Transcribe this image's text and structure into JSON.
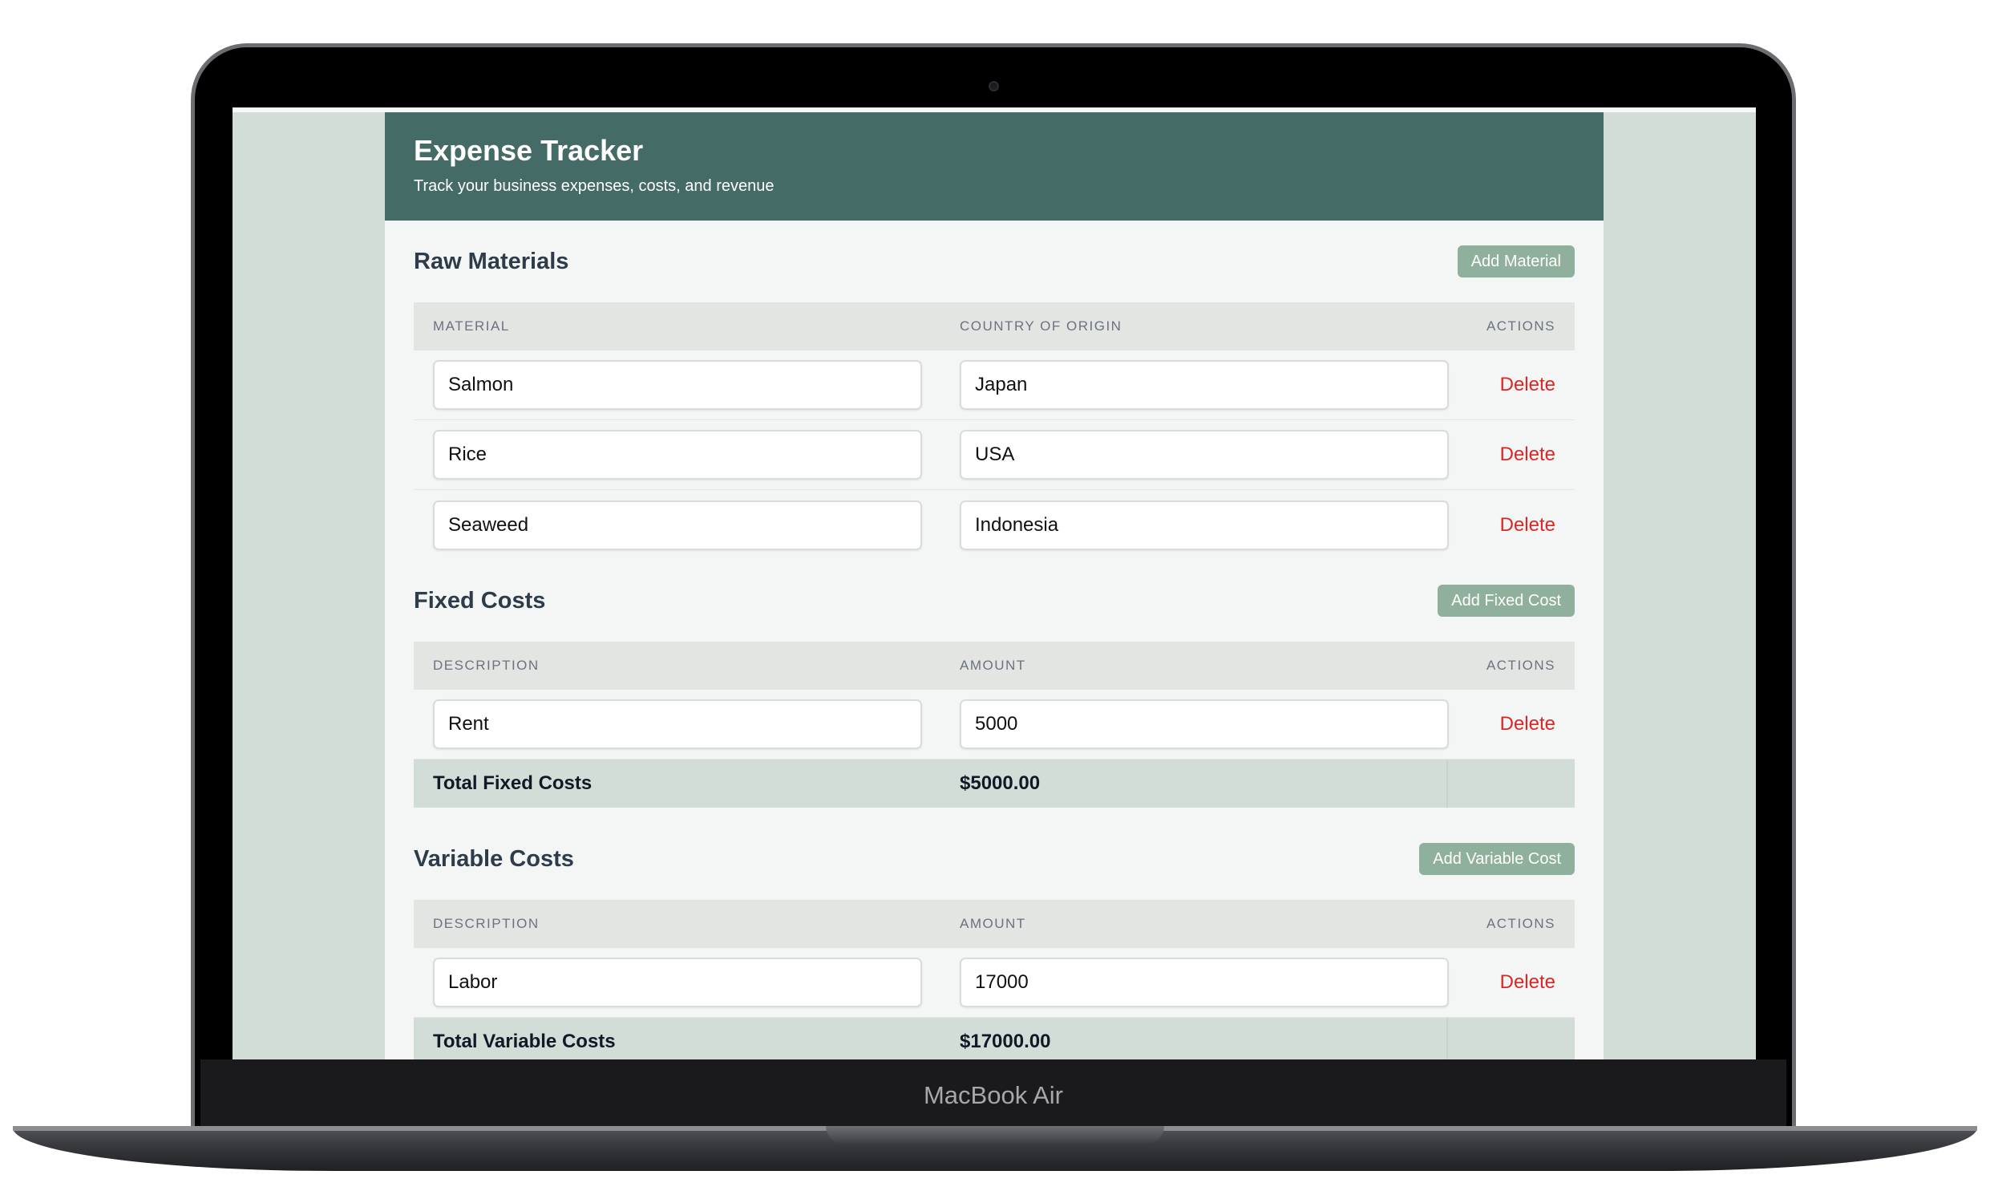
{
  "device": {
    "brand": "MacBook Air"
  },
  "header": {
    "title": "Expense Tracker",
    "subtitle": "Track your business expenses, costs, and revenue"
  },
  "raw_materials": {
    "title": "Raw Materials",
    "add_label": "Add Material",
    "columns": [
      "MATERIAL",
      "COUNTRY OF ORIGIN",
      "ACTIONS"
    ],
    "rows": [
      {
        "material": "Salmon",
        "country": "Japan",
        "action": "Delete"
      },
      {
        "material": "Rice",
        "country": "USA",
        "action": "Delete"
      },
      {
        "material": "Seaweed",
        "country": "Indonesia",
        "action": "Delete"
      }
    ]
  },
  "fixed_costs": {
    "title": "Fixed Costs",
    "add_label": "Add Fixed Cost",
    "columns": [
      "DESCRIPTION",
      "AMOUNT",
      "ACTIONS"
    ],
    "rows": [
      {
        "description": "Rent",
        "amount": "5000",
        "action": "Delete"
      }
    ],
    "total_label": "Total Fixed Costs",
    "total_value": "$5000.00"
  },
  "variable_costs": {
    "title": "Variable Costs",
    "add_label": "Add Variable Cost",
    "columns": [
      "DESCRIPTION",
      "AMOUNT",
      "ACTIONS"
    ],
    "rows": [
      {
        "description": "Labor",
        "amount": "17000",
        "action": "Delete"
      }
    ],
    "total_label": "Total Variable Costs",
    "total_value": "$17000.00"
  },
  "colors": {
    "header": "#446b66",
    "accent_button": "#8fb09d",
    "delete": "#dc2626",
    "page_bg": "#d3ddd7"
  }
}
